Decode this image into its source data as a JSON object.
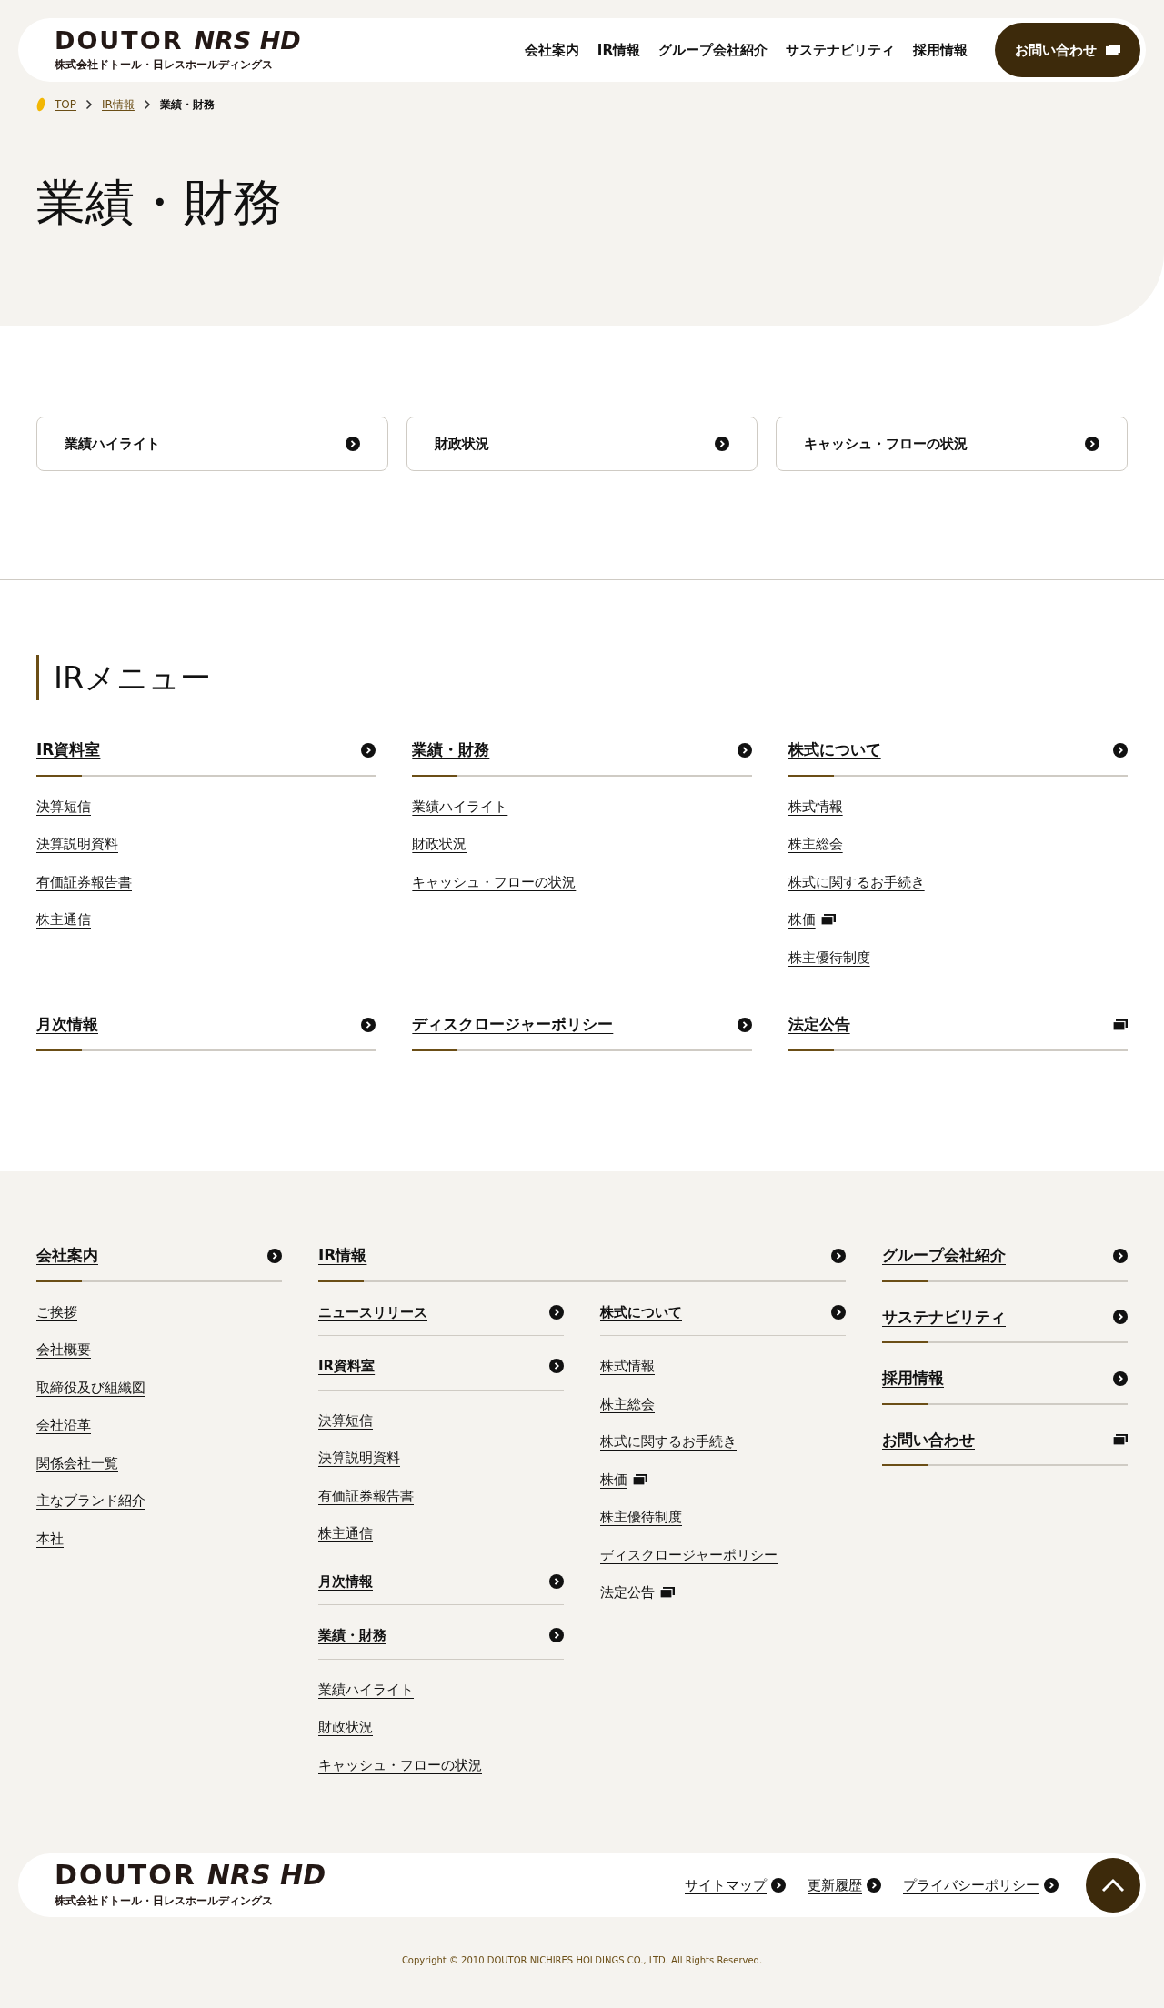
{
  "header": {
    "logo": {
      "brand": "DOUTOR",
      "sub_brand": "NRS HD",
      "company": "株式会社ドトール・日レスホールディングス"
    },
    "nav": [
      "会社案内",
      "IR情報",
      "グループ会社紹介",
      "サステナビリティ",
      "採用情報"
    ],
    "contact": "お問い合わせ"
  },
  "breadcrumb": [
    {
      "label": "TOP",
      "current": false
    },
    {
      "label": "IR情報",
      "current": false
    },
    {
      "label": "業績・財務",
      "current": true
    }
  ],
  "page_title": "業績・財務",
  "anchor_buttons": [
    "業績ハイライト",
    "財政状況",
    "キャッシュ・フローの状況"
  ],
  "ir_menu": {
    "title": "IRメニュー",
    "sections": [
      {
        "title": "IR資料室",
        "kind": "page",
        "links": [
          {
            "label": "決算短信",
            "external": false
          },
          {
            "label": "決算説明資料",
            "external": false
          },
          {
            "label": "有価証券報告書",
            "external": false
          },
          {
            "label": "株主通信",
            "external": false
          }
        ]
      },
      {
        "title": "業績・財務",
        "kind": "page",
        "links": [
          {
            "label": "業績ハイライト",
            "external": false
          },
          {
            "label": "財政状況",
            "external": false
          },
          {
            "label": "キャッシュ・フローの状況",
            "external": false
          }
        ]
      },
      {
        "title": "株式について",
        "kind": "page",
        "links": [
          {
            "label": "株式情報",
            "external": false
          },
          {
            "label": "株主総会",
            "external": false
          },
          {
            "label": "株式に関するお手続き",
            "external": false
          },
          {
            "label": "株価",
            "external": true
          },
          {
            "label": "株主優待制度",
            "external": false
          }
        ]
      },
      {
        "title": "月次情報",
        "kind": "page"
      },
      {
        "title": "ディスクロージャーポリシー",
        "kind": "page"
      },
      {
        "title": "法定公告",
        "kind": "external"
      }
    ]
  },
  "footer": {
    "company": {
      "title": "会社案内",
      "kind": "page",
      "links": [
        {
          "label": "ご挨拶",
          "external": false
        },
        {
          "label": "会社概要",
          "external": false
        },
        {
          "label": "取締役及び組織図",
          "external": false
        },
        {
          "label": "会社沿革",
          "external": false
        },
        {
          "label": "関係会社一覧",
          "external": false
        },
        {
          "label": "主なブランド紹介",
          "external": false
        },
        {
          "label": "本社",
          "external": false
        }
      ]
    },
    "ir": {
      "title": "IR情報",
      "kind": "page",
      "columns": [
        [
          {
            "title": "ニュースリリース",
            "kind": "page"
          },
          {
            "title": "IR資料室",
            "kind": "page",
            "links": [
              {
                "label": "決算短信",
                "external": false
              },
              {
                "label": "決算説明資料",
                "external": false
              },
              {
                "label": "有価証券報告書",
                "external": false
              },
              {
                "label": "株主通信",
                "external": false
              }
            ]
          },
          {
            "title": "月次情報",
            "kind": "page"
          },
          {
            "title": "業績・財務",
            "kind": "page",
            "links": [
              {
                "label": "業績ハイライト",
                "external": false
              },
              {
                "label": "財政状況",
                "external": false
              },
              {
                "label": "キャッシュ・フローの状況",
                "external": false
              }
            ]
          }
        ],
        [
          {
            "title": "株式について",
            "kind": "page",
            "links": [
              {
                "label": "株式情報",
                "external": false
              },
              {
                "label": "株主総会",
                "external": false
              },
              {
                "label": "株式に関するお手続き",
                "external": false
              },
              {
                "label": "株価",
                "external": true
              },
              {
                "label": "株主優待制度",
                "external": false
              },
              {
                "label": "ディスクロージャーポリシー",
                "external": false
              },
              {
                "label": "法定公告",
                "external": true
              }
            ]
          }
        ]
      ]
    },
    "others": [
      {
        "title": "グループ会社紹介",
        "kind": "page"
      },
      {
        "title": "サステナビリティ",
        "kind": "page"
      },
      {
        "title": "採用情報",
        "kind": "page"
      },
      {
        "title": "お問い合わせ",
        "kind": "external"
      }
    ],
    "logo": {
      "brand": "DOUTOR",
      "sub_brand": "NRS HD",
      "company": "株式会社ドトール・日レスホールディングス"
    },
    "bottom_links": [
      {
        "label": "サイトマップ",
        "kind": "page"
      },
      {
        "label": "更新履歴",
        "kind": "page"
      },
      {
        "label": "プライバシーポリシー",
        "kind": "page"
      }
    ],
    "copyright": "Copyright © 2010 DOUTOR NICHIRES HOLDINGS CO., LTD. All Rights Reserved."
  }
}
